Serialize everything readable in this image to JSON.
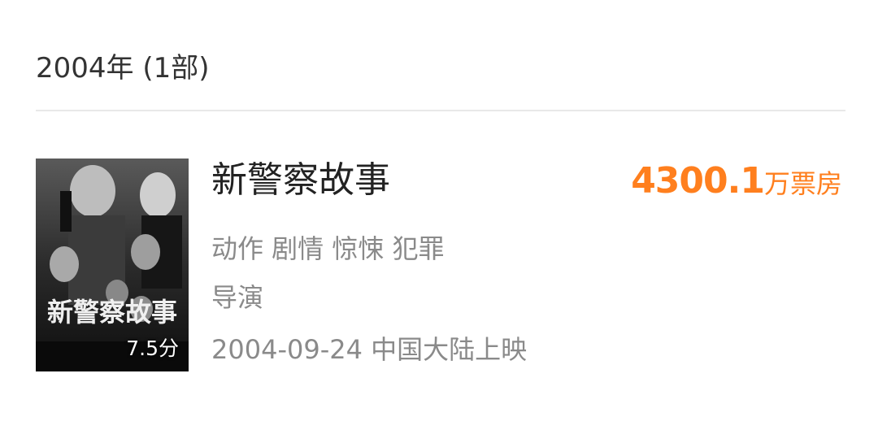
{
  "year_section": {
    "header": "2004年 (1部)"
  },
  "movie": {
    "title": "新警察故事",
    "box_office_amount": "4300.1",
    "box_office_unit": "万票房",
    "genres": "动作 剧情 惊悚 犯罪",
    "director_label": "导演",
    "release": "2004-09-24 中国大陆上映",
    "rating": "7.5分",
    "poster_title_text": "新警察故事",
    "accent_color": "#ff7f1e"
  }
}
